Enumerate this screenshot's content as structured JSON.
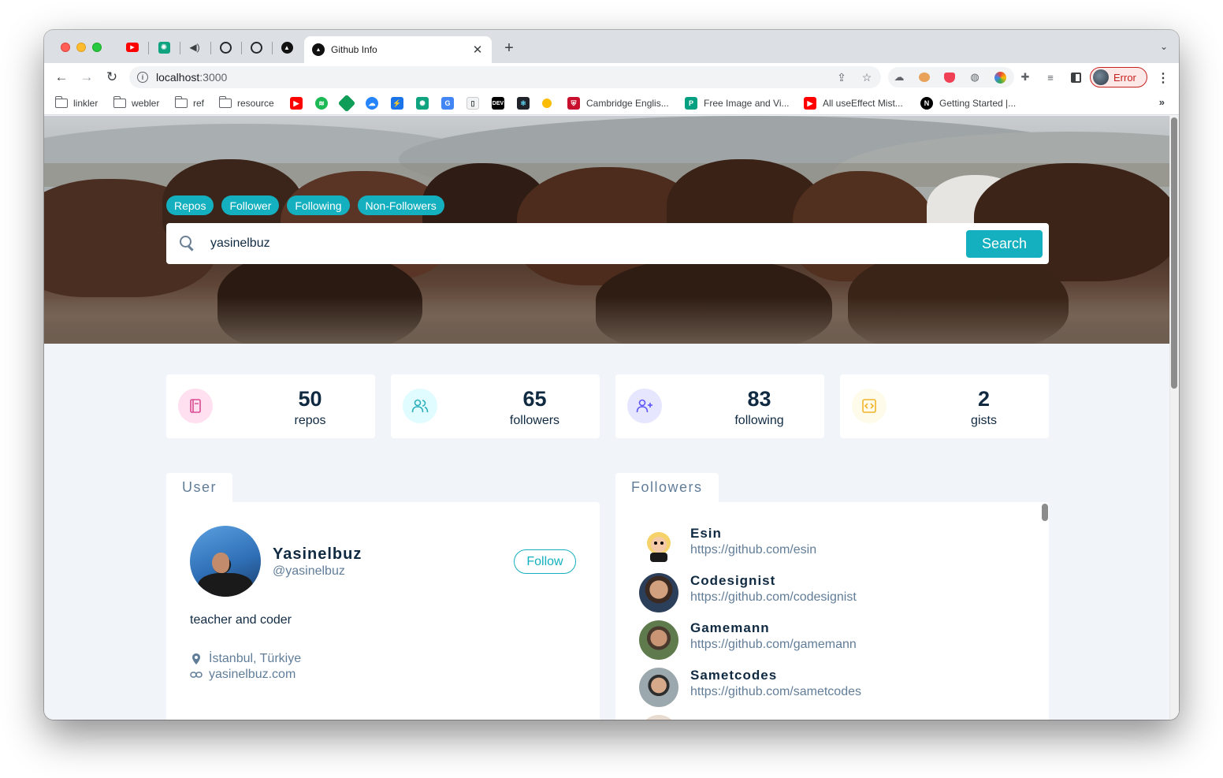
{
  "browser": {
    "active_tab_title": "Github Info",
    "url_host": "localhost",
    "url_port": ":3000",
    "profile_label": "Error",
    "bookmarks": {
      "folders": [
        "linkler",
        "webler",
        "ref",
        "resource"
      ],
      "sites": [
        "Cambridge Englis...",
        "Free Image and Vi...",
        "All useEffect Mist...",
        "Getting Started |..."
      ]
    }
  },
  "nav": {
    "chips": [
      "Repos",
      "Follower",
      "Following",
      "Non-Followers"
    ]
  },
  "search": {
    "value": "yasinelbuz",
    "button_label": "Search"
  },
  "stats": [
    {
      "value": "50",
      "label": "repos",
      "icon": "repo-book-icon",
      "color": "#da4a91",
      "bg": "#ffe0f0"
    },
    {
      "value": "65",
      "label": "followers",
      "icon": "users-icon",
      "color": "#2caeba",
      "bg": "#e0fcff"
    },
    {
      "value": "83",
      "label": "following",
      "icon": "user-plus-icon",
      "color": "#5d55fa",
      "bg": "#e6e6ff"
    },
    {
      "value": "2",
      "label": "gists",
      "icon": "code-icon",
      "color": "#f0b429",
      "bg": "#fffbea"
    }
  ],
  "user_card": {
    "tab_label": "User",
    "name": "Yasinelbuz",
    "handle": "@yasinelbuz",
    "follow_label": "Follow",
    "bio": "teacher and coder",
    "location": "İstanbul, Türkiye",
    "website": "yasinelbuz.com"
  },
  "followers_card": {
    "tab_label": "Followers",
    "items": [
      {
        "name": "Esin",
        "url": "https://github.com/esin"
      },
      {
        "name": "Codesignist",
        "url": "https://github.com/codesignist"
      },
      {
        "name": "Gamemann",
        "url": "https://github.com/gamemann"
      },
      {
        "name": "Sametcodes",
        "url": "https://github.com/sametcodes"
      }
    ]
  }
}
